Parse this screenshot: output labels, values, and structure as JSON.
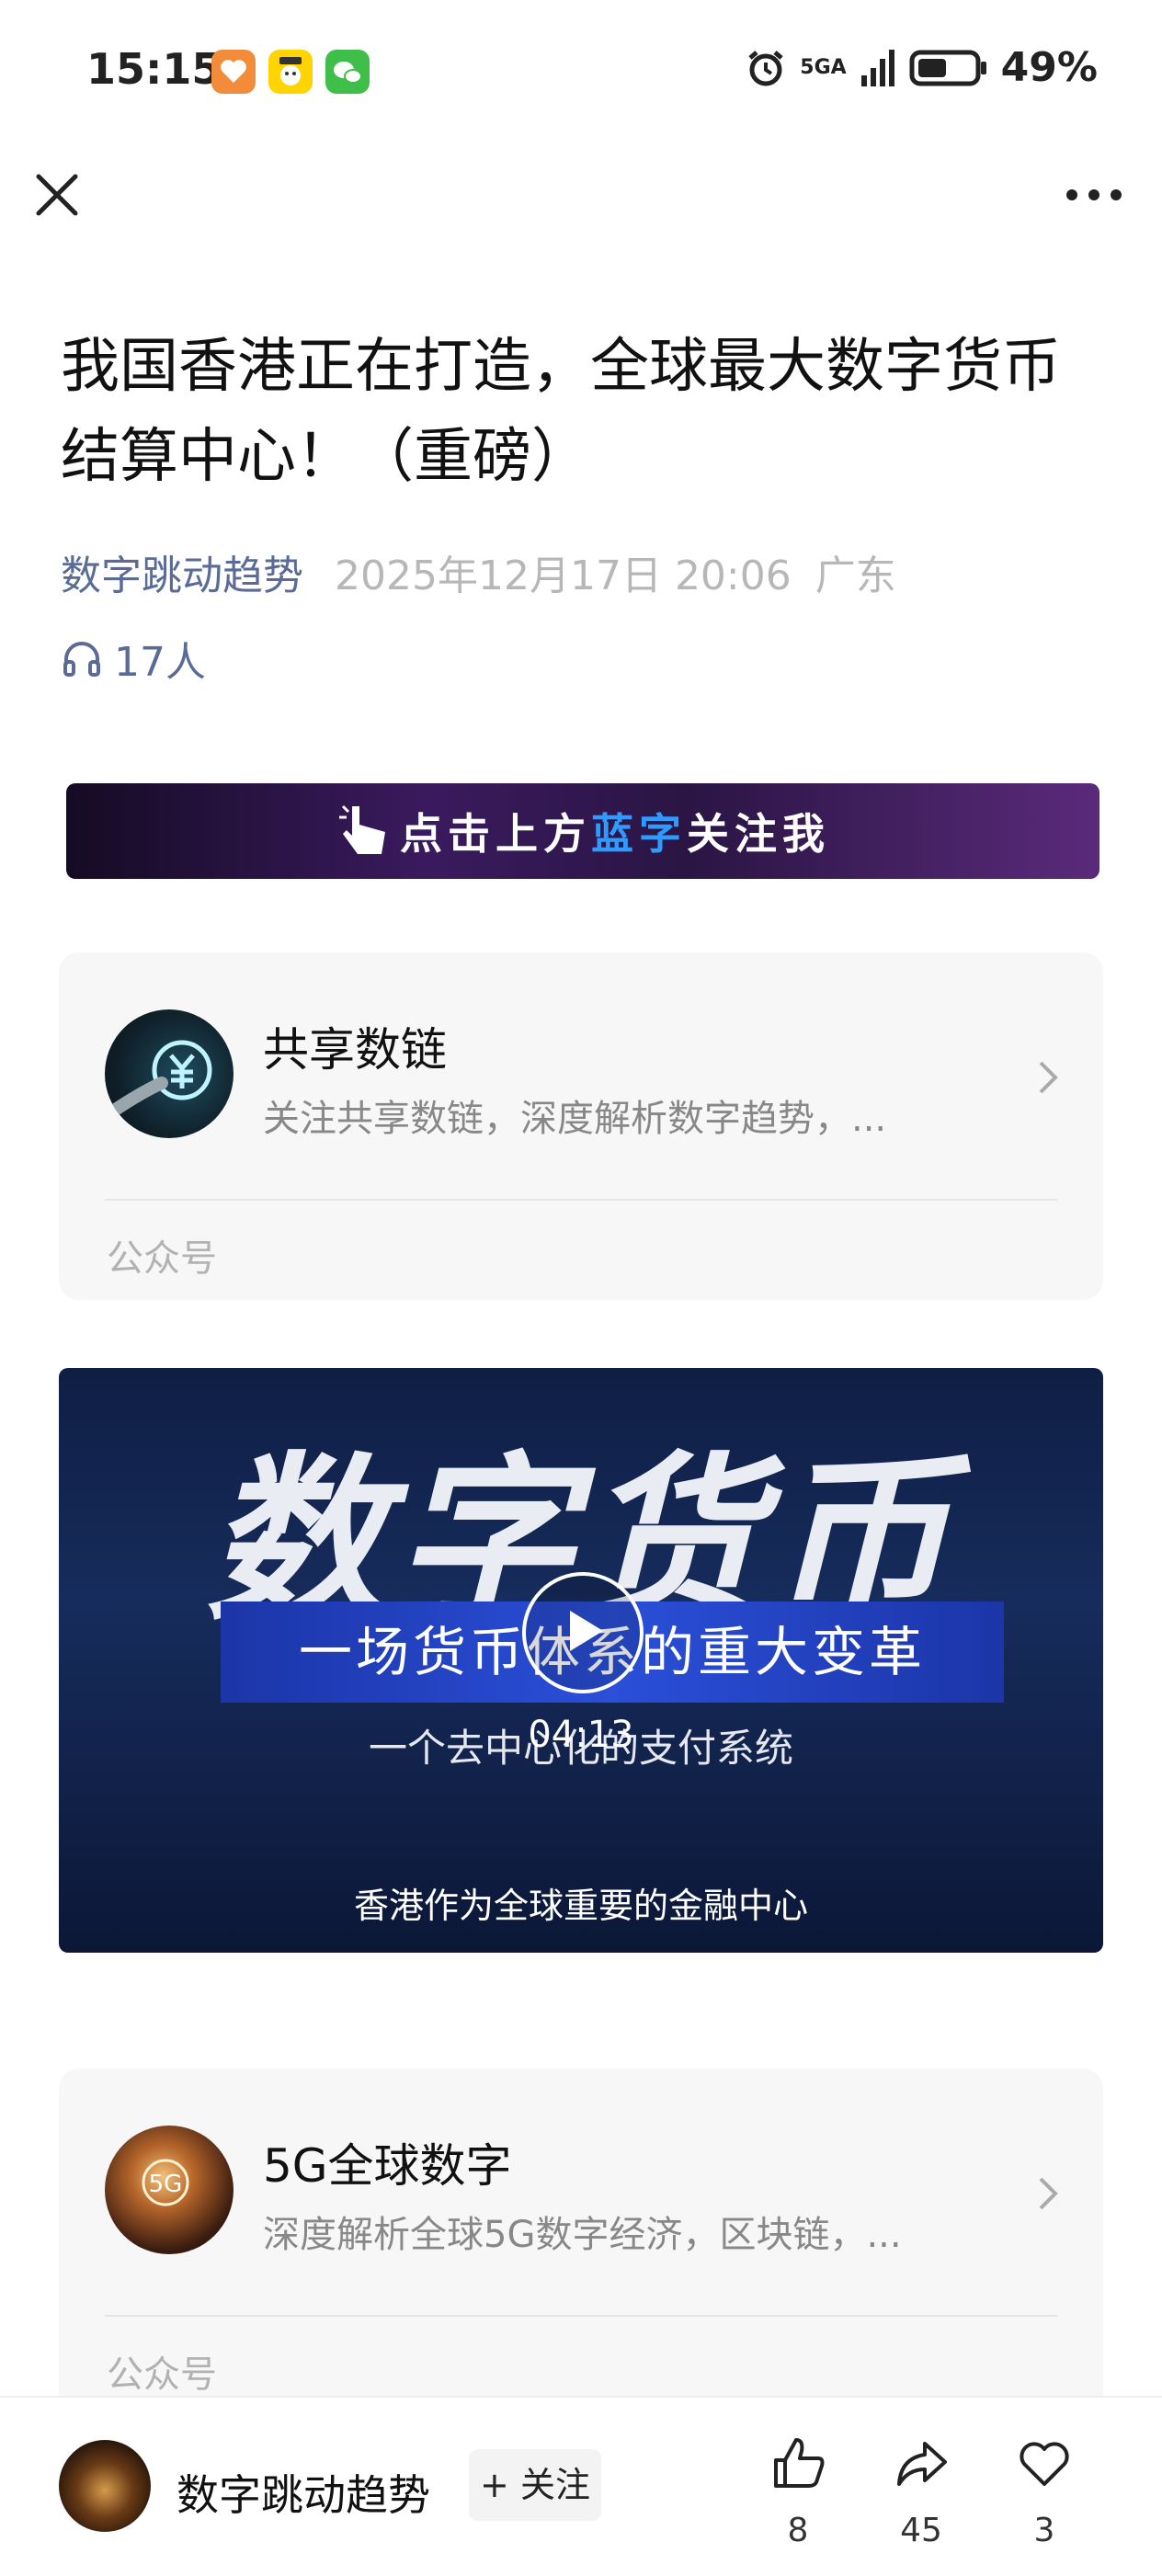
{
  "status_bar": {
    "time": "15:15",
    "network": "5GA",
    "battery": "49%",
    "icons": [
      "health-app-icon",
      "game-app-icon",
      "wechat-icon",
      "alarm-icon",
      "signal-icon",
      "battery-icon"
    ]
  },
  "toolbar": {
    "close_icon": "close-icon",
    "more_icon": "more-icon"
  },
  "article": {
    "title": "我国香港正在打造，全球最大数字货币结算中心！（重磅）",
    "author": "数字跳动趋势",
    "date": "2025年12月17日 20:06",
    "location": "广东",
    "listeners": "17人"
  },
  "banner": {
    "text_before": "点击上方",
    "text_blue": "蓝字",
    "text_after": "关注我"
  },
  "cards": [
    {
      "name": "共享数链",
      "desc": "关注共享数链，深度解析数字趋势，...",
      "type": "公众号"
    },
    {
      "name": "5G全球数字",
      "desc": "深度解析全球5G数字经济，区块链，...",
      "type": "公众号"
    }
  ],
  "video": {
    "headline": "数字货币",
    "band_text": "一场货币体系的重大变革",
    "subtitle": "一个去中心化的支付系统",
    "caption": "香港作为全球重要的金融中心",
    "duration": "04:13"
  },
  "bottom_bar": {
    "author": "数字跳动趋势",
    "follow_label": "+ 关注",
    "likes": "8",
    "shares": "45",
    "favorites": "3"
  },
  "colors": {
    "author_link": "#5a6b98",
    "banner_highlight": "#2f9bff"
  }
}
